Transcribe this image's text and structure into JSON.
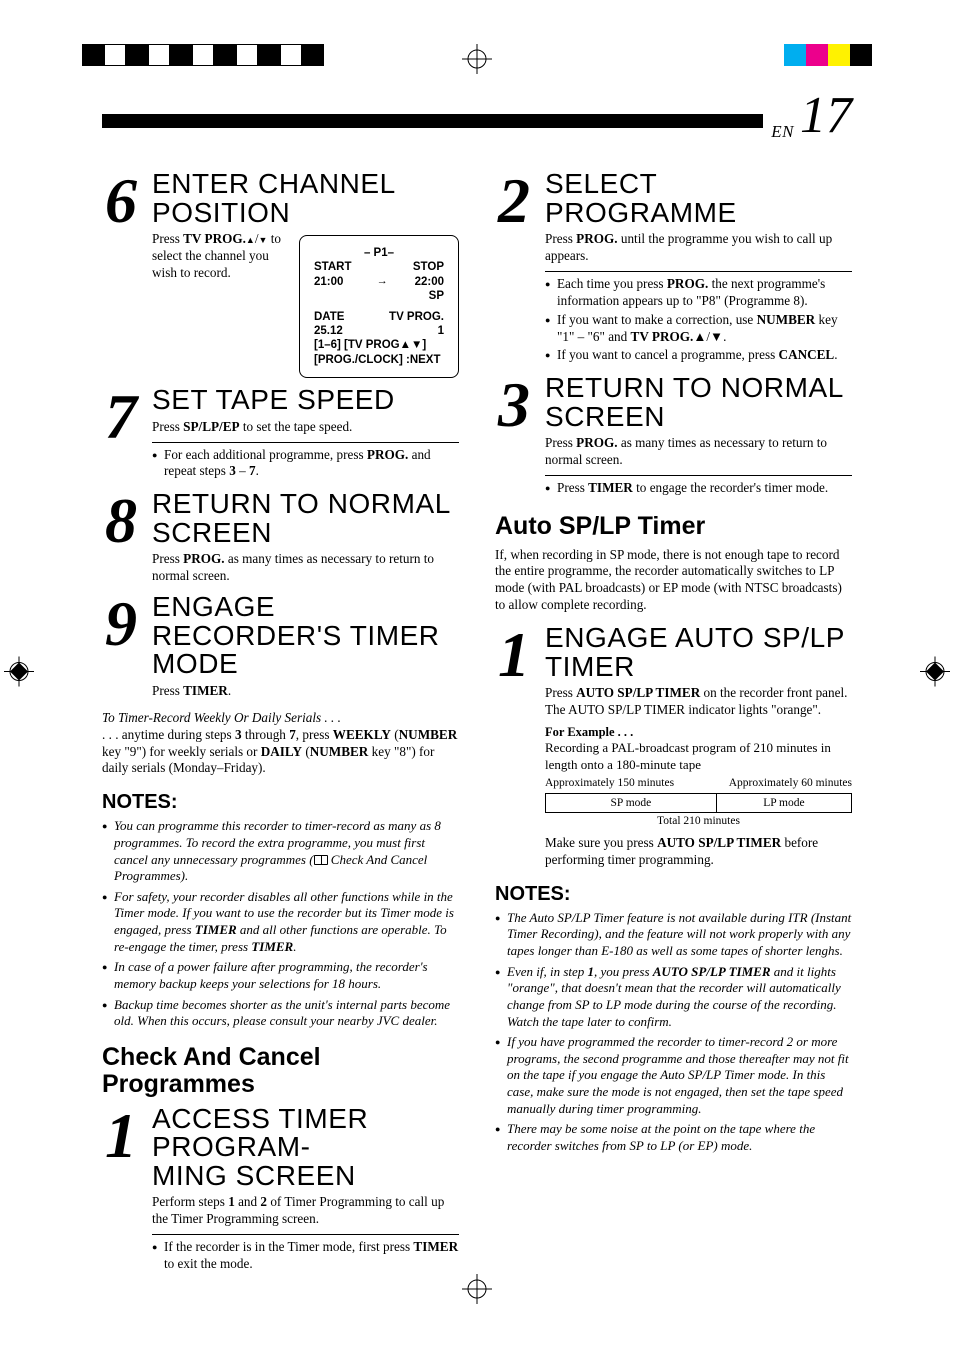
{
  "page": {
    "en_label": "EN",
    "number": "17"
  },
  "reg_colors_left": [
    "#000",
    "#fff",
    "#000",
    "#fff",
    "#000",
    "#fff",
    "#000",
    "#fff",
    "#000",
    "#fff",
    "#000"
  ],
  "reg_colors_right": [
    "#00aeef",
    "#ec008c",
    "#fff200",
    "#000000",
    "#fff",
    "#fff",
    "#fff",
    "#fff",
    "#fff",
    "#fff"
  ],
  "left": {
    "step6": {
      "num": "6",
      "title": "ENTER CHANNEL POSITION",
      "text_before": "Press ",
      "text_bold": "TV PROG.",
      "text_after": " to select the channel you wish to record.",
      "osd": {
        "p": "– P1–",
        "start_lbl": "START",
        "start_val": "21:00",
        "stop_lbl": "STOP",
        "stop_val": "22:00",
        "arrow": "→",
        "sp": "SP",
        "date_lbl": "DATE",
        "date_val": "25.12",
        "tvprog_lbl": "TV PROG.",
        "tvprog_val": "1",
        "line1": "[1–6] [TV PROG▲▼]",
        "line2": "[PROG./CLOCK] :NEXT"
      }
    },
    "step7": {
      "num": "7",
      "title": "SET TAPE SPEED",
      "text": "Press <b>SP/LP/EP</b> to set the tape speed.",
      "bullet": "For each additional programme, press <b>PROG.</b> and repeat steps <b>3</b> – <b>7</b>."
    },
    "step8": {
      "num": "8",
      "title": "RETURN TO NORMAL SCREEN",
      "text": "Press <b>PROG.</b> as many times as necessary to return to normal screen."
    },
    "step9": {
      "num": "9",
      "title": "ENGAGE RECORDER'S TIMER MODE",
      "text": "Press <b>TIMER</b>."
    },
    "weekly": {
      "lead_italic": "To Timer-Record Weekly Or Daily Serials . . .",
      "body": ". . . anytime during steps <b>3</b> through <b>7</b>, press <b>WEEKLY</b> (<b>NUMBER</b> key \"9\") for weekly serials or <b>DAILY</b> (<b>NUMBER</b> key \"8\") for daily serials (Monday–Friday)."
    },
    "notes_h": "NOTES:",
    "notes": [
      "You can programme this recorder to timer-record as many as 8 programmes. To record the extra programme, you must first cancel any unnecessary programmes (<span class=\"book-icon\" data-name=\"book-icon\" data-interactable=\"false\"></span> Check And Cancel Programmes).",
      "For safety, your recorder disables all other functions while in the Timer mode. If you want to use the recorder but its Timer mode is engaged, press <b>TIMER</b> and all other functions are operable. To re-engage the timer, press <b>TIMER</b>.",
      "In case of a power failure after programming, the recorder's memory backup keeps your selections for 18 hours.",
      "Backup time becomes shorter as the unit's internal parts become old. When this occurs, please consult your nearby JVC dealer."
    ],
    "check_h": "Check And Cancel Programmes",
    "step1b": {
      "num": "1",
      "title": "ACCESS TIMER PROGRAM-\nMING SCREEN",
      "text": "Perform steps <b>1</b> and <b>2</b> of Timer Programming to call up the Timer Programming screen.",
      "bullet": "If the recorder is in the Timer mode, first press <b>TIMER</b> to exit the mode."
    }
  },
  "right": {
    "step2": {
      "num": "2",
      "title": "SELECT PROGRAMME",
      "text": "Press <b>PROG.</b> until the programme you wish to call up appears.",
      "bullets": [
        "Each time you press <b>PROG.</b> the next programme's information appears up to \"P8\" (Programme 8).",
        "If you want to make a correction, use <b>NUMBER</b> key \"1\" – \"6\" and <b>TV PROG.</b>▲/▼.",
        "If you want to cancel a programme, press <b>CANCEL</b>."
      ]
    },
    "step3": {
      "num": "3",
      "title": "RETURN TO NORMAL SCREEN",
      "text": "Press <b>PROG.</b> as many times as necessary to return to normal screen.",
      "bullet": "Press <b>TIMER</b> to engage the recorder's timer mode."
    },
    "auto_h": "Auto SP/LP Timer",
    "auto_intro": "If, when recording in SP mode, there is not enough tape to record the entire programme, the recorder automatically switches to LP mode (with PAL broadcasts) or EP mode (with NTSC broadcasts) to allow complete recording.",
    "step1c": {
      "num": "1",
      "title": "ENGAGE AUTO SP/LP TIMER",
      "text": "Press <b>AUTO SP/LP TIMER</b> on the recorder front panel. The AUTO SP/LP TIMER indicator lights \"orange\".",
      "for_example": "For Example . . .",
      "example_body": "Recording a PAL-broadcast program of 210 minutes in length onto a 180-minute tape",
      "diag": {
        "left": "Approximately 150 minutes",
        "right": "Approximately 60 minutes",
        "sp": "SP mode",
        "lp": "LP mode",
        "total": "Total 210 minutes"
      },
      "after": "Make sure you press <b>AUTO SP/LP TIMER</b> before performing timer programming."
    },
    "notes_h": "NOTES:",
    "notes": [
      "The Auto SP/LP Timer feature is not available during ITR (Instant Timer Recording), and the feature will not work properly with any tapes longer than E-180 as well as some tapes of shorter lenghs.",
      "Even if, in step <b>1</b>, you press <b>AUTO SP/LP TIMER</b> and it lights \"orange\", that doesn't mean that the recorder will automatically change from SP to LP mode during the course of the recording. Watch the tape later to confirm.",
      "If you have programmed the recorder to timer-record 2 or more programs, the second programme and those thereafter may not fit on the tape if you engage the Auto SP/LP Timer mode. In this case, make sure the mode is not engaged, then set the tape speed manually during timer programming.",
      "There may be some noise at the point on the tape where the recorder switches from SP to LP (or EP) mode."
    ]
  }
}
